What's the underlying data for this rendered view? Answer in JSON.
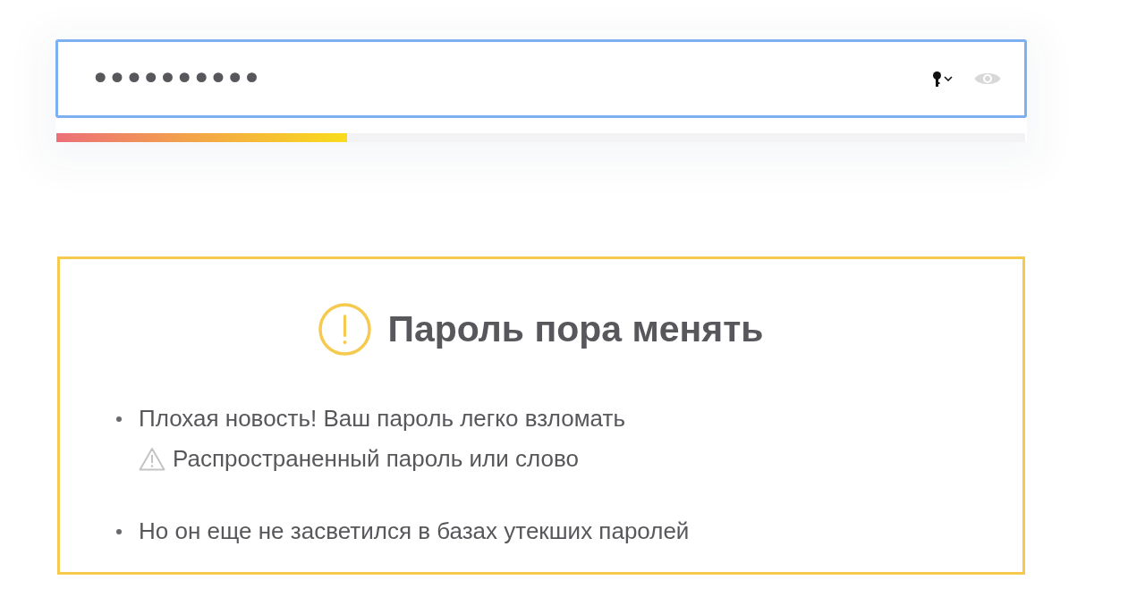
{
  "password_field": {
    "value": "••••••••••",
    "focused": true
  },
  "strength_meter": {
    "level": 0.3
  },
  "warning": {
    "title": "Пароль пора менять",
    "items": [
      {
        "text": "Плохая новость! Ваш пароль легко взломать",
        "note": {
          "text": "Распространенный пароль или слово"
        }
      },
      {
        "text": "Но он еще не засветился в базах утекших паролей"
      }
    ]
  }
}
